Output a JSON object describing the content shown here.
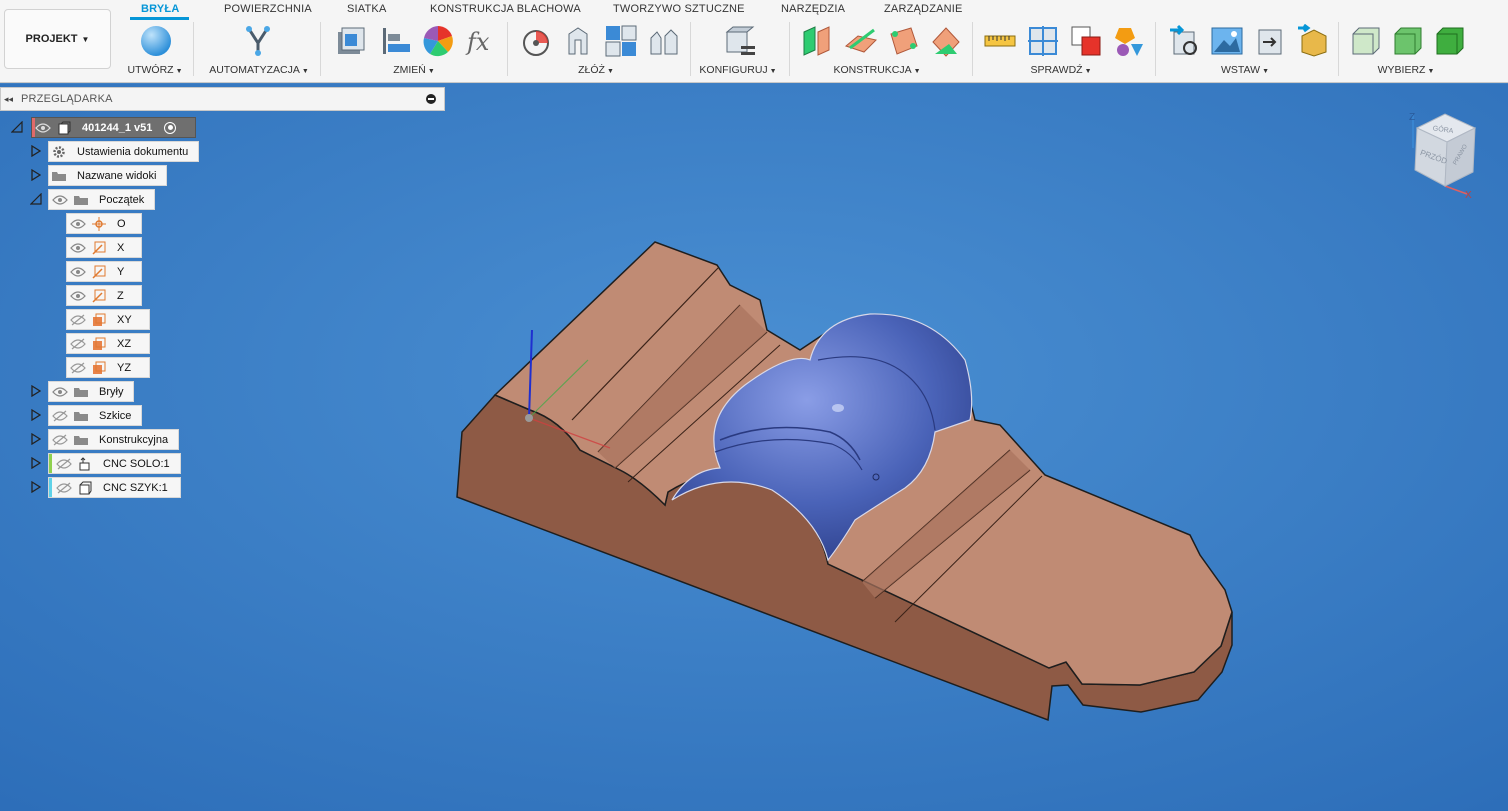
{
  "ribbon": {
    "project_label": "PROJEKT",
    "tabs": [
      "BRYŁA",
      "POWIERZCHNIA",
      "SIATKA",
      "KONSTRUKCJA BLACHOWA",
      "TWORZYWO SZTUCZNE",
      "NARZĘDZIA",
      "ZARZĄDZANIE"
    ],
    "groups": [
      "UTWÓRZ",
      "AUTOMATYZACJA",
      "ZMIEŃ",
      "ZŁÓŻ",
      "KONFIGURUJ",
      "KONSTRUKCJA",
      "SPRAWDŹ",
      "WSTAW",
      "WYBIERZ"
    ]
  },
  "browser": {
    "title": "PRZEGLĄDARKA",
    "root": "401244_1 v51",
    "items": [
      "Ustawienia dokumentu",
      "Nazwane widoki",
      "Początek",
      "O",
      "X",
      "Y",
      "Z",
      "XY",
      "XZ",
      "YZ",
      "Bryły",
      "Szkice",
      "Konstrukcyjna",
      "CNC SOLO:1",
      "CNC SZYK:1"
    ]
  },
  "viewcube": {
    "top": "GÓRA",
    "front": "PRZÓD",
    "right": "PRAWO",
    "axis_z": "Z",
    "axis_x": "X"
  },
  "colors": {
    "accent": "#0696d7",
    "viewport": "#3f7fc3",
    "part": "#c08b74",
    "part_dark": "#8e5a45",
    "feature": "#4a63b0",
    "stripe_solo": "#8fd14f",
    "stripe_szyk": "#5fd2e8"
  }
}
